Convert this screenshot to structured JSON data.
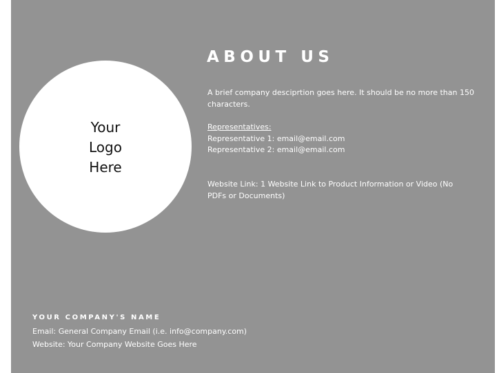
{
  "logo": {
    "text": "Your\nLogo\nHere"
  },
  "about": {
    "title": "ABOUT US",
    "description": "A brief company desciprtion goes here.  It should be no more than 150 characters.",
    "representatives_heading": "Representatives:",
    "representatives": [
      "Representative 1: email@email.com",
      "Representative 2: email@email.com"
    ],
    "website_link": "Website Link: 1 Website Link to Product Information or Video (No PDFs or Documents)"
  },
  "footer": {
    "company_name": "YOUR COMPANY'S NAME",
    "email": "Email: General Company Email (i.e. info@company.com)",
    "website": "Website: Your Company Website Goes Here"
  },
  "colors": {
    "background": "#939393",
    "logo_circle": "#ffffff",
    "text": "#ffffff"
  }
}
